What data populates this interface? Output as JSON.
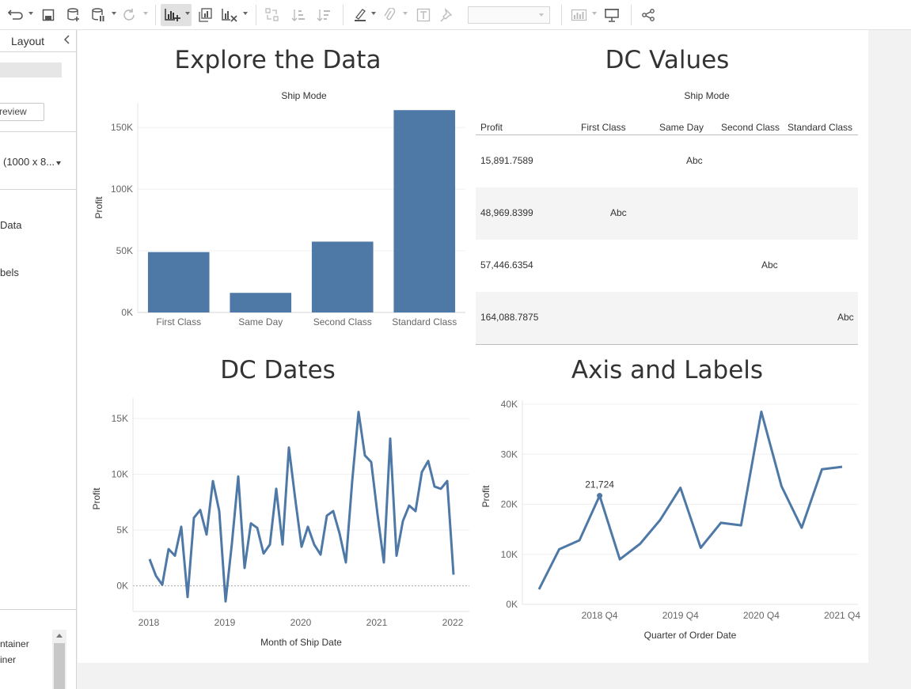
{
  "toolbar": {
    "icons": [
      "undo-redo-icon",
      "save-icon",
      "new-data-source-icon",
      "pause-updates-icon",
      "refresh-icon",
      "new-worksheet-icon",
      "duplicate-icon",
      "clear-sheet-icon",
      "swap-icon",
      "sort-ascending-icon",
      "sort-descending-icon",
      "highlight-icon",
      "group-icon",
      "show-labels-icon",
      "fix-axes-icon",
      "fit-select",
      "show-me-icon",
      "presentation-icon",
      "share-icon"
    ],
    "fit_select_value": ""
  },
  "left_panel": {
    "tab_label": "Layout",
    "collapse_icon": "chevron-left-icon",
    "preview_button": "review",
    "size_label": "(1000 x 8...",
    "item_data": "Data",
    "item_labels": "bels",
    "container_1": "ntainer",
    "container_2": "iner"
  },
  "dashboard": {
    "explore": {
      "title": "Explore the Data",
      "column_header": "Ship Mode",
      "chart_data": {
        "type": "bar",
        "categories": [
          "First Class",
          "Same Day",
          "Second Class",
          "Standard Class"
        ],
        "values": [
          48970,
          15892,
          57447,
          164089
        ],
        "ylabel": "Profit",
        "yticks": [
          "0K",
          "50K",
          "100K",
          "150K"
        ],
        "ylim": [
          0,
          170000
        ],
        "color": "#4e79a7"
      }
    },
    "dc_values": {
      "title": "DC Values",
      "column_header": "Ship Mode",
      "headers": [
        "Profit",
        "First Class",
        "Same Day",
        "Second Class",
        "Standard Class"
      ],
      "rows": [
        {
          "profit": "15,891.7589",
          "marker": "Abc",
          "col": 2
        },
        {
          "profit": "48,969.8399",
          "marker": "Abc",
          "col": 1
        },
        {
          "profit": "57,446.6354",
          "marker": "Abc",
          "col": 3
        },
        {
          "profit": "164,088.7875",
          "marker": "Abc",
          "col": 4
        }
      ]
    },
    "dc_dates": {
      "title": "DC Dates",
      "chart_data": {
        "type": "line",
        "xlabel": "Month of Ship Date",
        "ylabel": "Profit",
        "xticks": [
          "2018",
          "2019",
          "2020",
          "2021",
          "2022"
        ],
        "yticks": [
          "0K",
          "5K",
          "10K",
          "15K"
        ],
        "ylim": [
          -2300,
          16500
        ],
        "values": [
          2400,
          900,
          100,
          3300,
          2700,
          5300,
          -1000,
          6100,
          6800,
          4600,
          9400,
          6700,
          -1400,
          3800,
          9800,
          1600,
          5600,
          5200,
          2900,
          3700,
          8700,
          3700,
          12400,
          7800,
          3500,
          5300,
          3700,
          2800,
          6300,
          6700,
          4700,
          2100,
          9400,
          15600,
          11700,
          11100,
          6400,
          2100,
          13200,
          2700,
          5800,
          7200,
          6700,
          10200,
          11200,
          8900,
          8700,
          9400,
          1000
        ],
        "color": "#4e79a7"
      }
    },
    "axis_labels": {
      "title": "Axis and Labels",
      "chart_data": {
        "type": "line",
        "xlabel": "Quarter of Order Date",
        "ylabel": "Profit",
        "x": [
          "2018 Q1",
          "2018 Q2",
          "2018 Q3",
          "2018 Q4",
          "2019 Q1",
          "2019 Q2",
          "2019 Q3",
          "2019 Q4",
          "2020 Q1",
          "2020 Q2",
          "2020 Q3",
          "2020 Q4",
          "2021 Q1",
          "2021 Q2",
          "2021 Q3",
          "2021 Q4"
        ],
        "xticks": [
          "2018 Q4",
          "2019 Q4",
          "2020 Q4",
          "2021 Q4"
        ],
        "yticks": [
          "0K",
          "10K",
          "20K",
          "30K",
          "40K"
        ],
        "ylim": [
          0,
          40000
        ],
        "values": [
          3000,
          11000,
          12800,
          21724,
          9000,
          12100,
          16900,
          23300,
          11300,
          16300,
          15800,
          38500,
          23600,
          15300,
          27000,
          27500
        ],
        "annotation": {
          "index": 3,
          "text": "21,724"
        },
        "color": "#4e79a7"
      }
    }
  }
}
